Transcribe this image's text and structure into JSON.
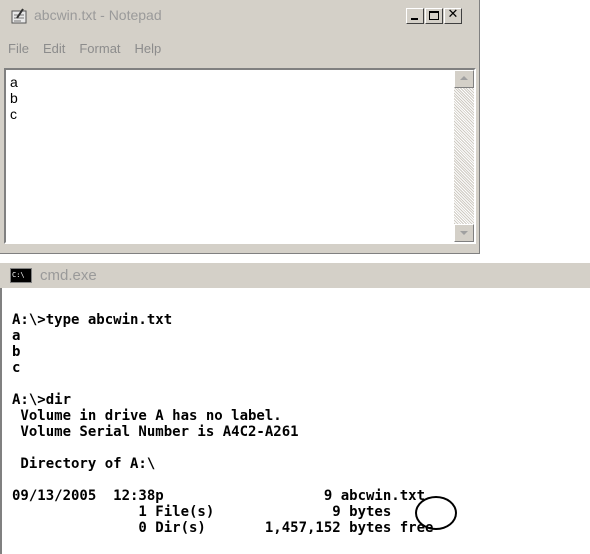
{
  "notepad": {
    "title": "abcwin.txt - Notepad",
    "title_icon": "notepad-icon",
    "menu": [
      "File",
      "Edit",
      "Format",
      "Help"
    ],
    "content": "a\nb\nc",
    "window_buttons": [
      "minimize-icon",
      "maximize-icon",
      "close-icon"
    ],
    "close_glyph": "✕"
  },
  "cmd": {
    "title": "cmd.exe",
    "icon_label": "C:\\",
    "lines": [
      "A:\\>type abcwin.txt",
      "a",
      "b",
      "c",
      "",
      "A:\\>dir",
      " Volume in drive A has no label.",
      " Volume Serial Number is A4C2-A261",
      "",
      " Directory of A:\\",
      "",
      "09/13/2005  12:38p                   9 abcwin.txt",
      "               1 File(s)              9 bytes",
      "               0 Dir(s)       1,457,152 bytes free"
    ]
  },
  "colors": {
    "window_bg": "#d4d0c8",
    "inactive_title_text": "#9a9a9a"
  }
}
